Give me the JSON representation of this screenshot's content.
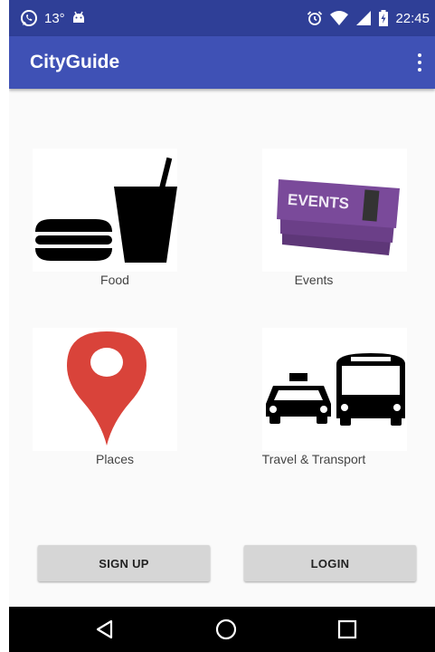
{
  "status_bar": {
    "temperature": "13°",
    "time": "22:45",
    "icons": [
      "whatsapp-icon",
      "android-icon",
      "alarm-icon",
      "wifi-icon",
      "signal-icon",
      "battery-charging-icon"
    ]
  },
  "app_bar": {
    "title": "CityGuide",
    "overflow_icon": "more-vert-icon"
  },
  "categories": [
    {
      "label": "Food",
      "icon": "food-icon"
    },
    {
      "label": "Events",
      "icon": "events-ticket-icon"
    },
    {
      "label": "Places",
      "icon": "map-pin-icon"
    },
    {
      "label": "Travel & Transport",
      "icon": "transport-icon"
    }
  ],
  "events_ticket_text": "EVENTS",
  "actions": {
    "signup_label": "SIGN UP",
    "login_label": "LOGIN"
  },
  "nav_bar": {
    "icons": [
      "back-icon",
      "home-icon",
      "recents-icon"
    ]
  },
  "colors": {
    "status_bar": "#2f3f97",
    "app_bar": "#3f51b5",
    "pin_red": "#d9433a",
    "ticket_purple": "#7a4a9a",
    "button_grey": "#d6d6d6"
  }
}
